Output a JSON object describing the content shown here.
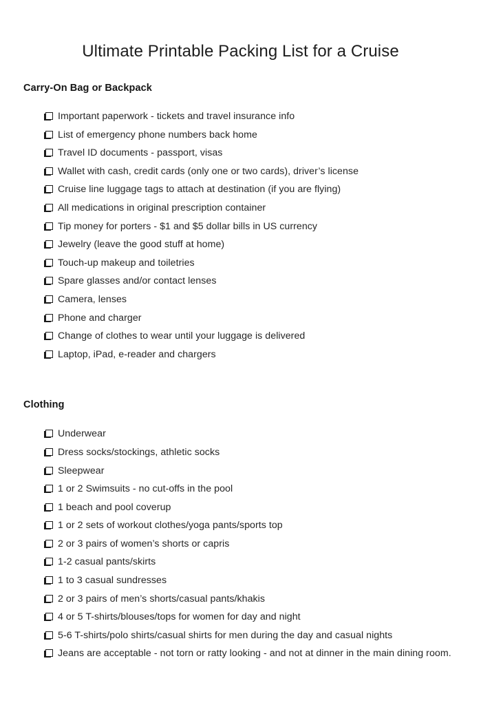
{
  "document": {
    "title": "Ultimate Printable Packing List for a Cruise",
    "checkbox_icon": "checkbox-empty-icon",
    "text_color": "#242424",
    "background_color": "#ffffff"
  },
  "sections": [
    {
      "heading": "Carry-On Bag or Backpack",
      "items": [
        "Important paperwork - tickets and travel insurance info",
        "List of emergency phone numbers back home",
        "Travel ID documents - passport, visas",
        "Wallet with cash, credit cards (only one or two cards), driver’s license",
        "Cruise line luggage tags to attach at destination (if you are flying)",
        "All medications in original prescription container",
        "Tip money for porters - $1 and $5 dollar bills in US currency",
        "Jewelry (leave the good stuff at home)",
        "Touch-up makeup and toiletries",
        "Spare glasses and/or contact lenses",
        "Camera, lenses",
        "Phone and charger",
        "Change of clothes to wear until your luggage is delivered",
        "Laptop, iPad, e-reader and chargers"
      ]
    },
    {
      "heading": "Clothing",
      "items": [
        "Underwear",
        "Dress socks/stockings, athletic socks",
        "Sleepwear",
        "1 or 2 Swimsuits - no cut-offs in the pool",
        "1 beach and pool coverup",
        "1 or 2 sets of workout clothes/yoga pants/sports top",
        "2 or 3 pairs of women’s shorts or capris",
        "1-2 casual pants/skirts",
        "1 to 3 casual sundresses",
        "2 or 3 pairs of men’s shorts/casual pants/khakis",
        "4 or 5 T-shirts/blouses/tops for women for day and night",
        "5-6 T-shirts/polo shirts/casual shirts for men during the day and casual nights",
        "Jeans are acceptable - not torn or ratty looking - and not at dinner in the main dining room."
      ]
    }
  ]
}
